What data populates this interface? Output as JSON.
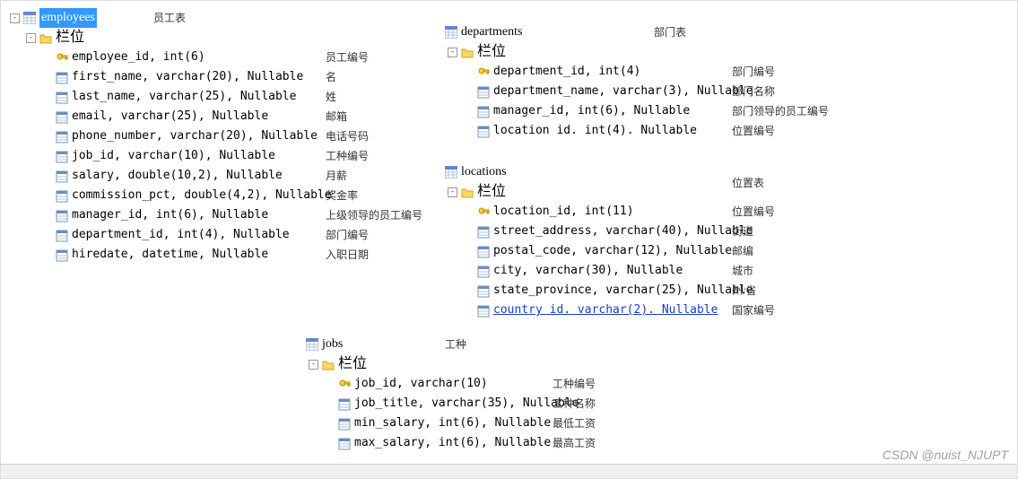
{
  "watermark": "CSDN @nuist_NJUPT",
  "expander_minus": "-",
  "expander_plus": "+",
  "folder_label": "栏位",
  "tables": {
    "employees": {
      "name": "employees",
      "selected": true,
      "table_desc": "员工表",
      "columns": [
        {
          "def": "employee_id, int(6)",
          "desc": "员工编号",
          "pk": true
        },
        {
          "def": "first_name, varchar(20), Nullable",
          "desc": "名",
          "pk": false
        },
        {
          "def": "last_name, varchar(25), Nullable",
          "desc": "姓",
          "pk": false
        },
        {
          "def": "email, varchar(25), Nullable",
          "desc": "邮箱",
          "pk": false
        },
        {
          "def": "phone_number, varchar(20), Nullable",
          "desc": "电话号码",
          "pk": false
        },
        {
          "def": "job_id, varchar(10), Nullable",
          "desc": "工种编号",
          "pk": false
        },
        {
          "def": "salary, double(10,2), Nullable",
          "desc": "月薪",
          "pk": false
        },
        {
          "def": "commission_pct, double(4,2), Nullable",
          "desc": "奖金率",
          "pk": false
        },
        {
          "def": "manager_id, int(6), Nullable",
          "desc": "上级领导的员工编号",
          "pk": false
        },
        {
          "def": "department_id, int(4), Nullable",
          "desc": "部门编号",
          "pk": false
        },
        {
          "def": "hiredate, datetime, Nullable",
          "desc": "入职日期",
          "pk": false
        }
      ]
    },
    "departments": {
      "name": "departments",
      "table_desc": "部门表",
      "columns": [
        {
          "def": "department_id, int(4)",
          "desc": "部门编号",
          "pk": true
        },
        {
          "def": "department_name, varchar(3), Nullable",
          "desc": "部门名称",
          "pk": false
        },
        {
          "def": "manager_id, int(6), Nullable",
          "desc": "部门领导的员工编号",
          "pk": false
        },
        {
          "def": "location id. int(4). Nullable",
          "desc": "位置编号",
          "pk": false
        }
      ]
    },
    "locations": {
      "name": "locations",
      "table_desc": "位置表",
      "columns": [
        {
          "def": "location_id, int(11)",
          "desc": "位置编号",
          "pk": true
        },
        {
          "def": "street_address, varchar(40), Nullable",
          "desc": "街道",
          "pk": false
        },
        {
          "def": "postal_code, varchar(12), Nullable",
          "desc": "邮编",
          "pk": false
        },
        {
          "def": "city, varchar(30), Nullable",
          "desc": "城市",
          "pk": false
        },
        {
          "def": "state_province, varchar(25), Nullable",
          "desc": "州/省",
          "pk": false
        },
        {
          "def": "country id. varchar(2). Nullable",
          "desc": "国家编号",
          "pk": false,
          "underline": true
        }
      ]
    },
    "jobs": {
      "name": "jobs",
      "table_desc": "工种",
      "columns": [
        {
          "def": "job_id, varchar(10)",
          "desc": "工种编号",
          "pk": true
        },
        {
          "def": "job_title, varchar(35), Nullable",
          "desc": "工种名称",
          "pk": false
        },
        {
          "def": "min_salary, int(6), Nullable",
          "desc": "最低工资",
          "pk": false
        },
        {
          "def": "max_salary, int(6), Nullable",
          "desc": "最高工资",
          "pk": false
        }
      ]
    }
  }
}
